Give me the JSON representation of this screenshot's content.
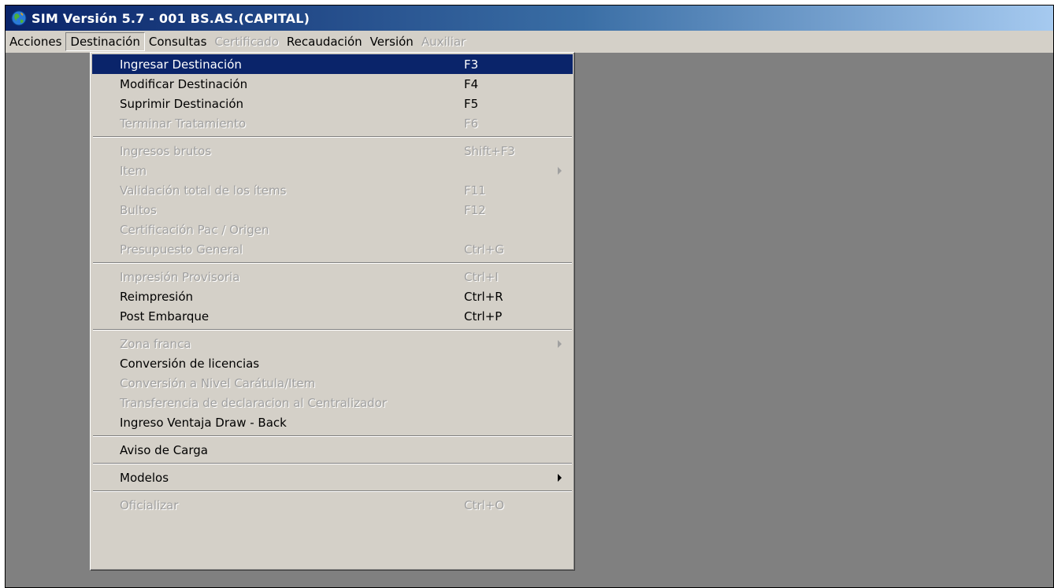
{
  "window": {
    "title": "SIM Versión 5.7 - 001 BS.AS.(CAPITAL)",
    "icon": "globe-icon"
  },
  "menubar": [
    {
      "label": "Acciones",
      "enabled": true,
      "open": false
    },
    {
      "label": "Destinación",
      "enabled": true,
      "open": true
    },
    {
      "label": "Consultas",
      "enabled": true,
      "open": false
    },
    {
      "label": "Certificado",
      "enabled": false,
      "open": false
    },
    {
      "label": "Recaudación",
      "enabled": true,
      "open": false
    },
    {
      "label": "Versión",
      "enabled": true,
      "open": false
    },
    {
      "label": "Auxiliar",
      "enabled": false,
      "open": false
    }
  ],
  "dropdown": {
    "items": [
      {
        "label": "Ingresar Destinación",
        "shortcut": "F3",
        "enabled": true,
        "selected": true
      },
      {
        "label": "Modificar Destinación",
        "shortcut": "F4",
        "enabled": true
      },
      {
        "label": "Suprimir Destinación",
        "shortcut": "F5",
        "enabled": true
      },
      {
        "label": "Terminar Tratamiento",
        "shortcut": "F6",
        "enabled": false
      },
      {
        "label": "Ingresos brutos",
        "shortcut": "Shift+F3",
        "enabled": false
      },
      {
        "label": "Item",
        "shortcut": "",
        "enabled": false,
        "submenu": true
      },
      {
        "label": "Validación total de los ítems",
        "shortcut": "F11",
        "enabled": false
      },
      {
        "label": "Bultos",
        "shortcut": "F12",
        "enabled": false
      },
      {
        "label": "Certificación Pac / Origen",
        "shortcut": "",
        "enabled": false
      },
      {
        "label": "Presupuesto General",
        "shortcut": "Ctrl+G",
        "enabled": false
      },
      {
        "label": "Impresión Provisoria",
        "shortcut": "Ctrl+I",
        "enabled": false
      },
      {
        "label": "Reimpresión",
        "shortcut": "Ctrl+R",
        "enabled": true
      },
      {
        "label": "Post Embarque",
        "shortcut": "Ctrl+P",
        "enabled": true
      },
      {
        "label": "Zona franca",
        "shortcut": "",
        "enabled": false,
        "submenu": true
      },
      {
        "label": "Conversión de licencias",
        "shortcut": "",
        "enabled": true
      },
      {
        "label": "Conversión a Nivel Carátula/Item",
        "shortcut": "",
        "enabled": false
      },
      {
        "label": "Transferencia de declaracion al Centralizador",
        "shortcut": "",
        "enabled": false
      },
      {
        "label": "Ingreso Ventaja Draw - Back",
        "shortcut": "",
        "enabled": true
      },
      {
        "label": "Aviso de Carga",
        "shortcut": "",
        "enabled": true
      },
      {
        "label": "Modelos",
        "shortcut": "",
        "enabled": true,
        "submenu": true
      },
      {
        "label": "Oficializar",
        "shortcut": "Ctrl+O",
        "enabled": false
      }
    ]
  },
  "colors": {
    "selection": "#0a246a",
    "menu_bg": "#d4d0c8",
    "workspace": "#808080",
    "disabled_text": "#a0a0a0"
  }
}
